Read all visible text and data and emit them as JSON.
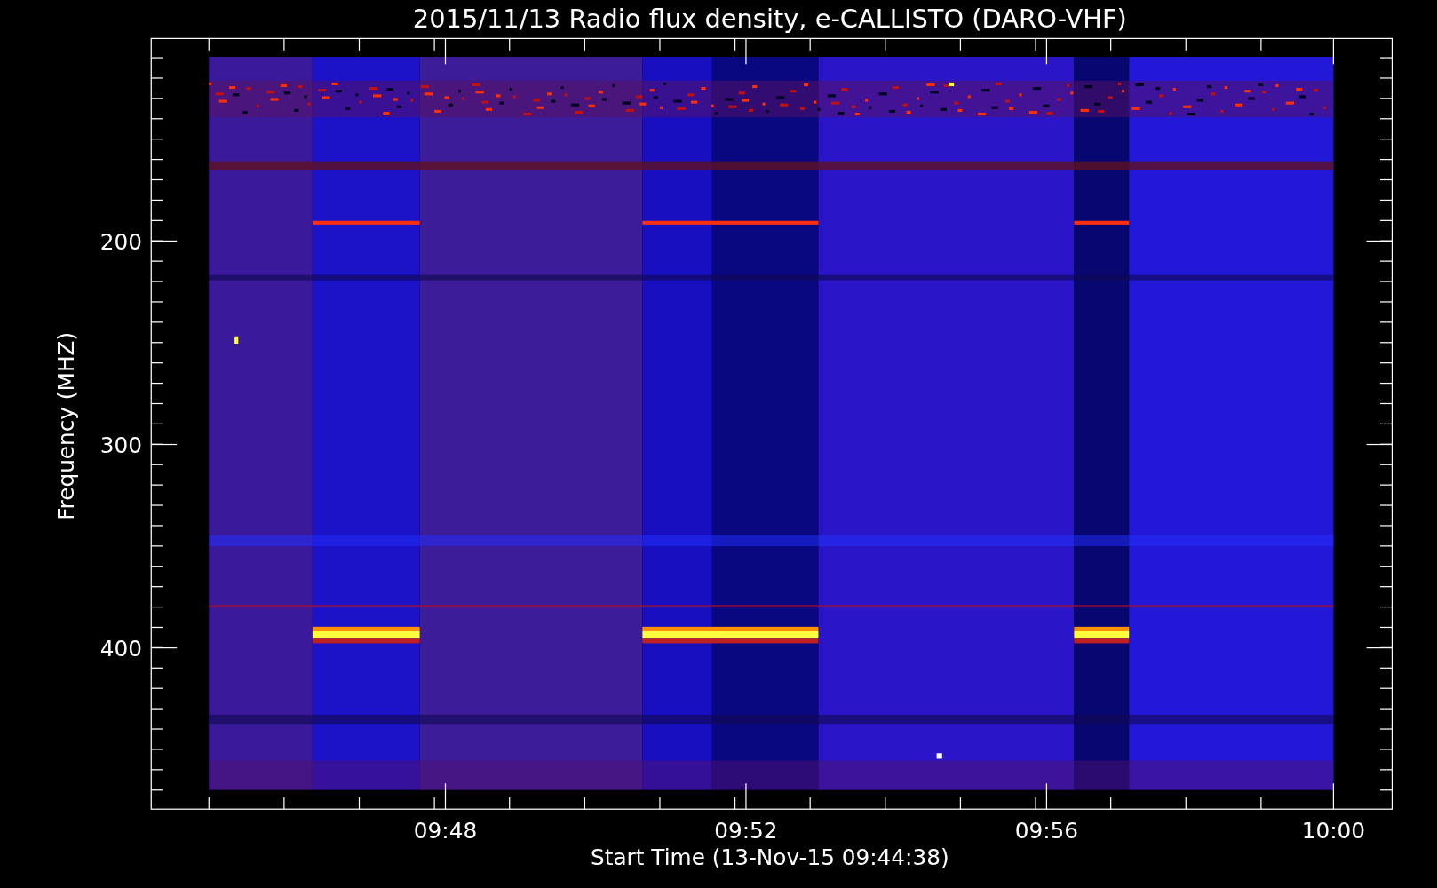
{
  "chart": {
    "title": "2015/11/13  Radio flux density, e-CALLISTO (DARO-VHF)",
    "xlabel": "Start Time (13-Nov-15 09:44:38)",
    "ylabel": "Frequency (MHZ)",
    "y_tick_labels": [
      "200",
      "300",
      "400"
    ],
    "x_tick_labels": [
      "09:48",
      "09:52",
      "09:56",
      "10:00"
    ]
  }
}
